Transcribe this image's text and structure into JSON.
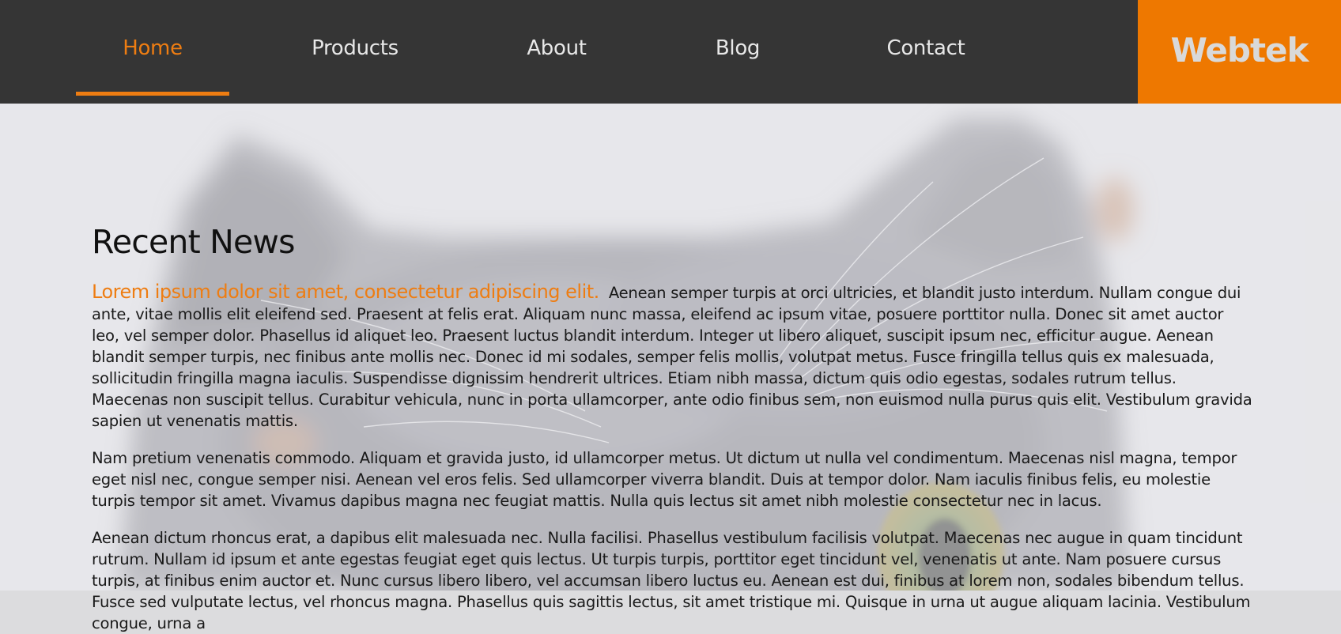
{
  "nav": {
    "items": [
      {
        "label": "Home",
        "active": true
      },
      {
        "label": "Products",
        "active": false
      },
      {
        "label": "About",
        "active": false
      },
      {
        "label": "Blog",
        "active": false
      },
      {
        "label": "Contact",
        "active": false
      }
    ]
  },
  "brand": {
    "name": "Webtek"
  },
  "colors": {
    "accent": "#ee7800",
    "header_bg": "#353535",
    "nav_text": "#e8e8e8",
    "brand_text": "#d9d9d9"
  },
  "news": {
    "title": "Recent News",
    "articles": [
      {
        "headline": "Lorem ipsum dolor sit amet, consectetur adipiscing elit.",
        "body": "Aenean semper turpis at orci ultricies, et blandit justo interdum. Nullam congue dui ante, vitae mollis elit eleifend sed. Praesent at felis erat. Aliquam nunc massa, eleifend ac ipsum vitae, posuere porttitor nulla. Donec sit amet auctor leo, vel semper dolor. Phasellus id aliquet leo. Praesent luctus blandit interdum. Integer ut libero aliquet, suscipit ipsum nec, efficitur augue. Aenean blandit semper turpis, nec finibus ante mollis nec. Donec id mi sodales, semper felis mollis, volutpat metus. Fusce fringilla tellus quis ex malesuada, sollicitudin fringilla magna iaculis. Suspendisse dignissim hendrerit ultrices. Etiam nibh massa, dictum quis odio egestas, sodales rutrum tellus. Maecenas non suscipit tellus. Curabitur vehicula, nunc in porta ullamcorper, ante odio finibus sem, non euismod nulla purus quis elit. Vestibulum gravida sapien ut venenatis mattis."
      },
      {
        "body": "Nam pretium venenatis commodo. Aliquam et gravida justo, id ullamcorper metus. Ut dictum ut nulla vel condimentum. Maecenas nisl magna, tempor eget nisl nec, congue semper nisi. Aenean vel eros felis. Sed ullamcorper viverra blandit. Duis at tempor dolor. Nam iaculis finibus felis, eu molestie turpis tempor sit amet. Vivamus dapibus magna nec feugiat mattis. Nulla quis lectus sit amet nibh molestie consectetur nec in lacus."
      },
      {
        "body": "Aenean dictum rhoncus erat, a dapibus elit malesuada nec. Nulla facilisi. Phasellus vestibulum facilisis volutpat. Maecenas nec augue in quam tincidunt rutrum. Nullam id ipsum et ante egestas feugiat eget quis lectus. Ut turpis turpis, porttitor eget tincidunt vel, venenatis ut ante. Nam posuere cursus turpis, at finibus enim auctor et. Nunc cursus libero libero, vel accumsan libero luctus eu. Aenean est dui, finibus at lorem non, sodales bibendum tellus. Fusce sed vulputate lectus, vel rhoncus magna. Phasellus quis sagittis lectus, sit amet tristique mi. Quisque in urna ut augue aliquam lacinia. Vestibulum congue, urna a"
      }
    ]
  }
}
